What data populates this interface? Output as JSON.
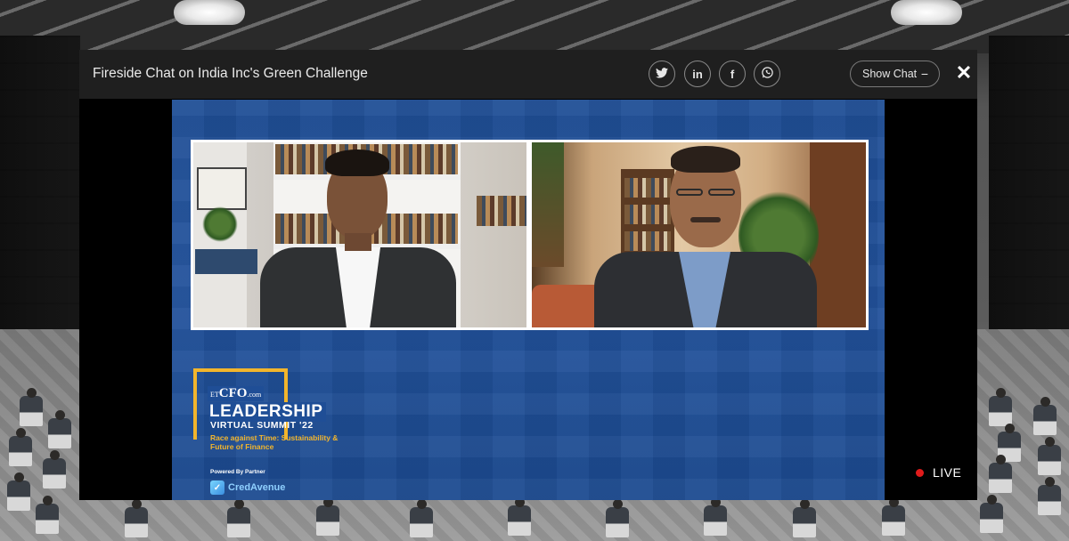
{
  "window": {
    "title": "Fireside Chat on India Inc's Green Challenge"
  },
  "share": {
    "twitter": "🐦",
    "linkedin": "in",
    "facebook": "f",
    "whatsapp": "✆"
  },
  "header": {
    "show_chat_label": "Show Chat",
    "show_chat_toggle": "−",
    "close": "✕"
  },
  "video": {
    "brand_logo_prefix": "ET",
    "brand_logo": "CFO",
    "brand_logo_suffix": ".com",
    "brand_title": "LEADERSHIP",
    "brand_subtitle": "VIRTUAL SUMMIT '22",
    "brand_tagline": "Race against Time: Sustainability & Future of Finance",
    "powered_by": "Powered By Partner",
    "partner_name": "CredAvenue",
    "partner_mark": "✓"
  },
  "status": {
    "live_label": "LIVE",
    "live_color": "#e01b1b"
  },
  "colors": {
    "titlebar": "#1f1f1f",
    "video_bg": "#1f4e96",
    "accent_gold": "#f2b52c"
  }
}
